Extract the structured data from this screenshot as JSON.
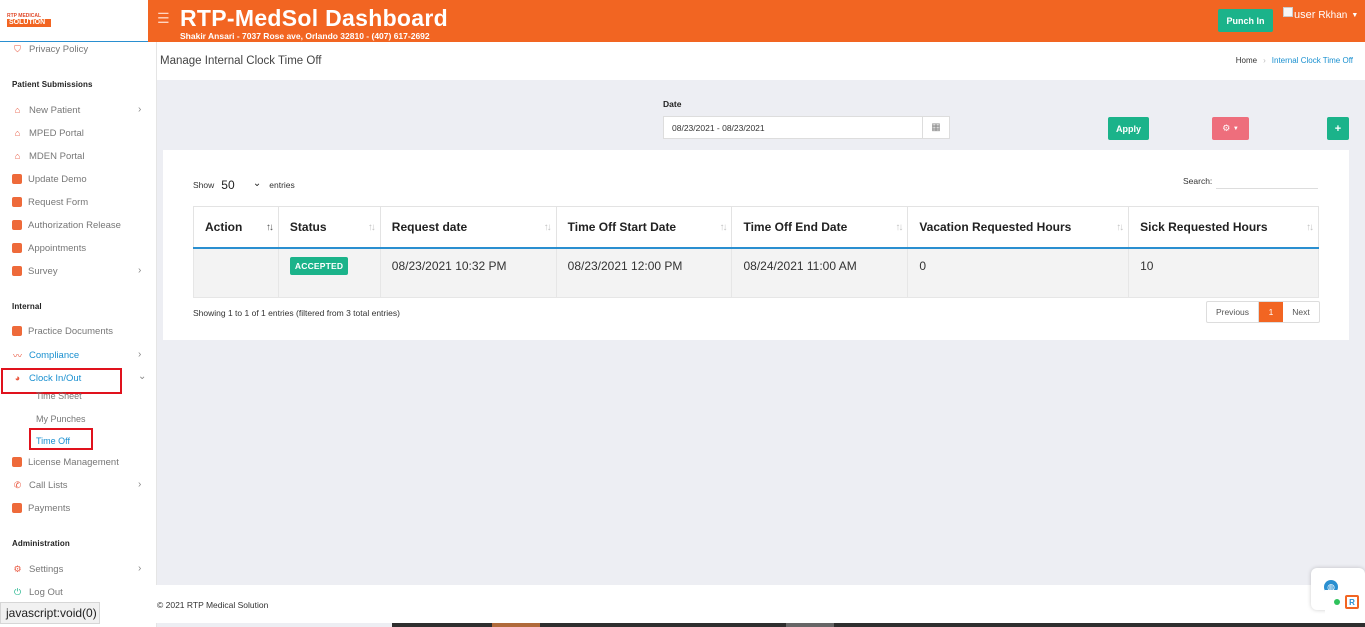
{
  "brand": {
    "logo_top": "RTP MEDICAL",
    "logo_main": "SOLUTION"
  },
  "header": {
    "title": "RTP-MedSol Dashboard",
    "subtitle": "Shakir Ansari - 7037 Rose ave, Orlando 32810 - (407) 617-2692",
    "punch_in": "Punch In",
    "user_alt": "user",
    "user_name": "Rkhan"
  },
  "sidebar": {
    "privacy": "Privacy Policy",
    "sec_patient": "Patient Submissions",
    "new_patient": "New Patient",
    "mped": "MPED Portal",
    "mden": "MDEN Portal",
    "update_demo": "Update Demo",
    "request_form": "Request Form",
    "auth_release": "Authorization Release",
    "appointments": "Appointments",
    "survey": "Survey",
    "sec_internal": "Internal",
    "practice_docs": "Practice Documents",
    "compliance": "Compliance",
    "clock": "Clock In/Out",
    "time_sheet": "Time Sheet",
    "my_punches": "My Punches",
    "time_off": "Time Off",
    "license": "License Management",
    "call_lists": "Call Lists",
    "payments": "Payments",
    "sec_admin": "Administration",
    "settings": "Settings",
    "logout": "Log Out"
  },
  "status_tip": "javascript:void(0)",
  "page": {
    "title": "Manage Internal Clock Time Off",
    "crumb_home": "Home",
    "crumb_current": "Internal Clock Time Off"
  },
  "filter": {
    "date_label": "Date",
    "date_value": "08/23/2021 - 08/23/2021",
    "apply": "Apply",
    "add": "+"
  },
  "table": {
    "show_label": "Show",
    "show_value": "50",
    "entries_label": "entries",
    "search_label": "Search:",
    "columns": [
      "Action",
      "Status",
      "Request date",
      "Time Off Start Date",
      "Time Off End Date",
      "Vacation Requested Hours",
      "Sick Requested Hours"
    ],
    "rows": [
      {
        "action": "",
        "status": "ACCEPTED",
        "request_date": "08/23/2021 10:32 PM",
        "start": "08/23/2021 12:00 PM",
        "end": "08/24/2021 11:00 AM",
        "vacation": "0",
        "sick": "10"
      }
    ],
    "info": "Showing 1 to 1 of 1 entries (filtered from 3 total entries)",
    "prev": "Previous",
    "page": "1",
    "next": "Next"
  },
  "footer": {
    "copyright": "© 2021 RTP Medical Solution"
  },
  "colors": {
    "brand": "#f26522",
    "green": "#1bb38a",
    "blue": "#2a8fd0",
    "pink": "#ee6e7c"
  }
}
